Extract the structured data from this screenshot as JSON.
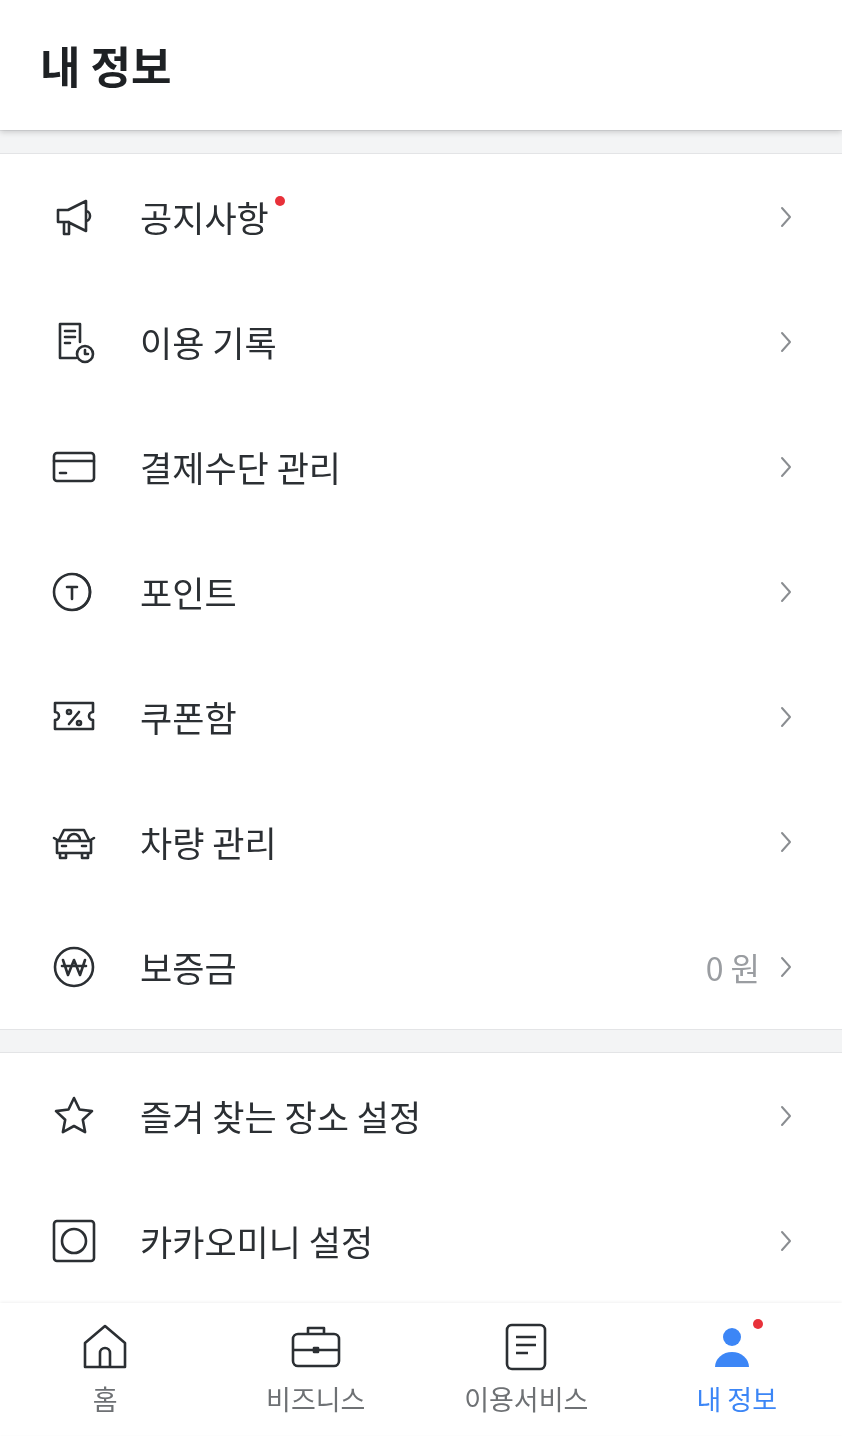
{
  "header": {
    "title": "내 정보"
  },
  "sections": [
    {
      "items": [
        {
          "label": "공지사항",
          "badge": true
        },
        {
          "label": "이용 기록",
          "badge": false
        },
        {
          "label": "결제수단 관리",
          "badge": false
        },
        {
          "label": "포인트",
          "badge": false
        },
        {
          "label": "쿠폰함",
          "badge": false
        },
        {
          "label": "차량 관리",
          "badge": false
        },
        {
          "label": "보증금",
          "badge": false,
          "value": "0 원"
        }
      ]
    },
    {
      "items": [
        {
          "label": "즐겨 찾는 장소 설정",
          "badge": false
        },
        {
          "label": "카카오미니 설정",
          "badge": false
        }
      ]
    }
  ],
  "tab_bar": [
    {
      "label": "홈",
      "selected": false,
      "badge": false
    },
    {
      "label": "비즈니스",
      "selected": false,
      "badge": false
    },
    {
      "label": "이용서비스",
      "selected": false,
      "badge": false
    },
    {
      "label": "내 정보",
      "selected": true,
      "badge": true
    }
  ]
}
